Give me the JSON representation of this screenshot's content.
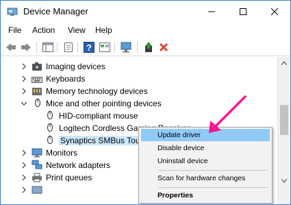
{
  "window": {
    "title": "Device Manager"
  },
  "menubar": {
    "items": [
      "File",
      "Action",
      "View",
      "Help"
    ]
  },
  "tree": {
    "rows": [
      {
        "label": "Imaging devices",
        "level": 0,
        "icon": "camera-icon"
      },
      {
        "label": "Keyboards",
        "level": 0,
        "icon": "keyboard-icon"
      },
      {
        "label": "Memory technology devices",
        "level": 0,
        "icon": "memory-card-icon"
      },
      {
        "label": "Mice and other pointing devices",
        "level": 0,
        "icon": "mouse-icon",
        "expanded": true
      },
      {
        "label": "HID-compliant mouse",
        "level": 1,
        "icon": "mouse-icon"
      },
      {
        "label": "Logitech Cordless Gaming Receiver",
        "level": 1,
        "icon": "mouse-icon"
      },
      {
        "label": "Synaptics SMBus TouchPad",
        "level": 1,
        "icon": "mouse-icon",
        "selected": true
      },
      {
        "label": "Monitors",
        "level": 0,
        "icon": "monitor-icon"
      },
      {
        "label": "Network adapters",
        "level": 0,
        "icon": "network-icon"
      },
      {
        "label": "Print queues",
        "level": 0,
        "icon": "printer-icon"
      }
    ]
  },
  "context_menu": {
    "items": [
      {
        "label": "Update driver",
        "highlighted": true
      },
      {
        "label": "Disable device"
      },
      {
        "label": "Uninstall device"
      },
      {
        "label": "Scan for hardware changes"
      },
      {
        "label": "Properties",
        "bold": true
      }
    ]
  },
  "colors": {
    "selection": "#cce8ff",
    "menu_highlight": "#91c9f7",
    "annotation_arrow": "#ff1493",
    "delete_x": "#d9452b"
  }
}
